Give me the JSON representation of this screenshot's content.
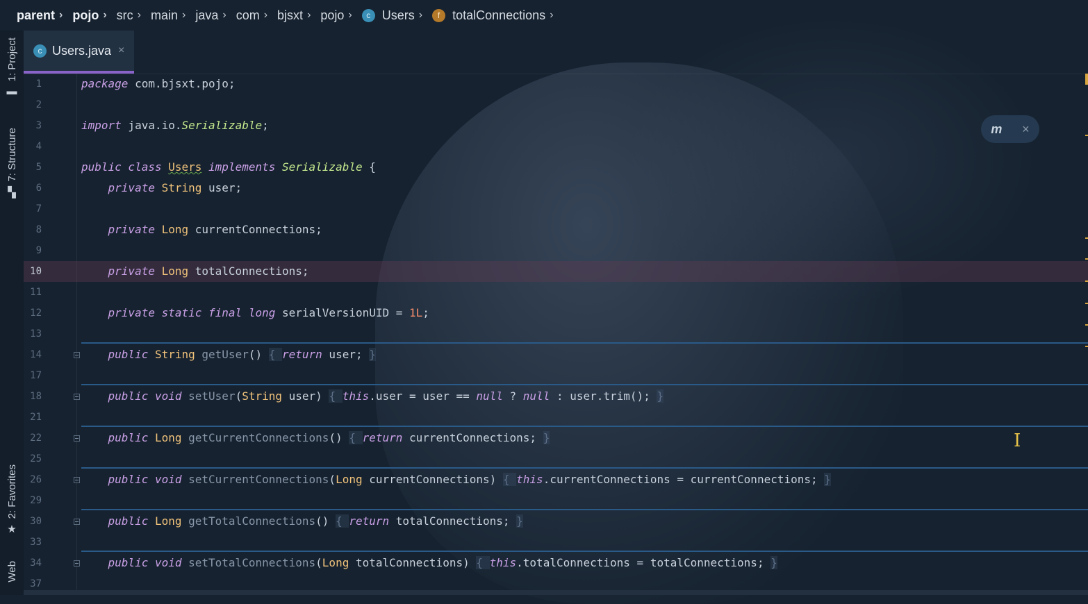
{
  "breadcrumb": [
    {
      "label": "parent",
      "bold": true
    },
    {
      "label": "pojo",
      "bold": true
    },
    {
      "label": "src"
    },
    {
      "label": "main"
    },
    {
      "label": "java"
    },
    {
      "label": "com"
    },
    {
      "label": "bjsxt"
    },
    {
      "label": "pojo"
    },
    {
      "label": "Users",
      "icon": "class-icon",
      "icon_glyph": "c"
    },
    {
      "label": "totalConnections",
      "icon": "field-icon",
      "icon_glyph": "f"
    }
  ],
  "toolstrip": {
    "project": {
      "label": "1: Project",
      "icon": "folder-icon"
    },
    "structure": {
      "label": "7: Structure",
      "icon": "structure-icon"
    },
    "favorites": {
      "label": "2: Favorites",
      "icon": "star-icon"
    },
    "web": {
      "label": "Web"
    }
  },
  "tab": {
    "label": "Users.java",
    "icon": "class-icon",
    "icon_glyph": "c",
    "close": "×"
  },
  "maven_popup": {
    "label": "m",
    "close": "×"
  },
  "colors": {
    "accent": "#8a63c9",
    "keyword": "#c9a0e6",
    "type": "#f0c27b",
    "number": "#f78c6c",
    "marker": "#d7a640"
  },
  "lines": [
    {
      "n": "1",
      "tokens": [
        [
          "kw",
          "package"
        ],
        [
          "pl",
          " com.bjsxt.pojo;"
        ]
      ]
    },
    {
      "n": "2",
      "tokens": []
    },
    {
      "n": "3",
      "tokens": [
        [
          "kw",
          "import"
        ],
        [
          "pl",
          " java.io."
        ],
        [
          "ty-i",
          "Serializable"
        ],
        [
          "pl",
          ";"
        ]
      ]
    },
    {
      "n": "4",
      "tokens": []
    },
    {
      "n": "5",
      "tokens": [
        [
          "kw",
          "public class "
        ],
        [
          "cls",
          "Users"
        ],
        [
          "kw",
          " implements "
        ],
        [
          "ty-i",
          "Serializable"
        ],
        [
          "pl",
          " {"
        ]
      ]
    },
    {
      "n": "6",
      "tokens": [
        [
          "pl",
          "    "
        ],
        [
          "kw",
          "private "
        ],
        [
          "ty",
          "String"
        ],
        [
          "pl",
          " user;"
        ]
      ]
    },
    {
      "n": "7",
      "tokens": []
    },
    {
      "n": "8",
      "tokens": [
        [
          "pl",
          "    "
        ],
        [
          "kw",
          "private "
        ],
        [
          "ty",
          "Long"
        ],
        [
          "pl",
          " currentConnections;"
        ]
      ]
    },
    {
      "n": "9",
      "tokens": []
    },
    {
      "n": "10",
      "current": true,
      "tokens": [
        [
          "pl",
          "    "
        ],
        [
          "kw",
          "private "
        ],
        [
          "ty",
          "Long"
        ],
        [
          "pl",
          " totalConnections;"
        ]
      ]
    },
    {
      "n": "11",
      "tokens": []
    },
    {
      "n": "12",
      "tokens": [
        [
          "pl",
          "    "
        ],
        [
          "kw",
          "private static final long "
        ],
        [
          "pl",
          "serialVersionUID = "
        ],
        [
          "nm",
          "1L"
        ],
        [
          "pl",
          ";"
        ]
      ]
    },
    {
      "n": "13",
      "tokens": []
    },
    {
      "n": "14",
      "fold": true,
      "sep": true,
      "tokens": [
        [
          "pl",
          "    "
        ],
        [
          "kw",
          "public "
        ],
        [
          "ty",
          "String"
        ],
        [
          "fn",
          " getUser"
        ],
        [
          "pl",
          "() "
        ],
        [
          "br",
          "{ "
        ],
        [
          "kw",
          "return"
        ],
        [
          "pl",
          " user; "
        ],
        [
          "br",
          "}"
        ]
      ]
    },
    {
      "n": "17",
      "tokens": []
    },
    {
      "n": "18",
      "fold": true,
      "sep": true,
      "tokens": [
        [
          "pl",
          "    "
        ],
        [
          "kw",
          "public void "
        ],
        [
          "fn",
          "setUser"
        ],
        [
          "pl",
          "("
        ],
        [
          "ty",
          "String"
        ],
        [
          "pl",
          " user) "
        ],
        [
          "br",
          "{ "
        ],
        [
          "kw",
          "this"
        ],
        [
          "pl",
          ".user = user == "
        ],
        [
          "kw",
          "null"
        ],
        [
          "pl",
          " ? "
        ],
        [
          "kw",
          "null"
        ],
        [
          "pl",
          " : user.trim(); "
        ],
        [
          "br",
          "}"
        ]
      ]
    },
    {
      "n": "21",
      "tokens": []
    },
    {
      "n": "22",
      "fold": true,
      "sep": true,
      "tokens": [
        [
          "pl",
          "    "
        ],
        [
          "kw",
          "public "
        ],
        [
          "ty",
          "Long"
        ],
        [
          "fn",
          " getCurrentConnections"
        ],
        [
          "pl",
          "() "
        ],
        [
          "br",
          "{ "
        ],
        [
          "kw",
          "return"
        ],
        [
          "pl",
          " currentConnections; "
        ],
        [
          "br",
          "}"
        ]
      ]
    },
    {
      "n": "25",
      "tokens": []
    },
    {
      "n": "26",
      "fold": true,
      "sep": true,
      "tokens": [
        [
          "pl",
          "    "
        ],
        [
          "kw",
          "public void "
        ],
        [
          "fn",
          "setCurrentConnections"
        ],
        [
          "pl",
          "("
        ],
        [
          "ty",
          "Long"
        ],
        [
          "pl",
          " currentConnections) "
        ],
        [
          "br",
          "{ "
        ],
        [
          "kw",
          "this"
        ],
        [
          "pl",
          ".currentConnections = currentConnections; "
        ],
        [
          "br",
          "}"
        ]
      ]
    },
    {
      "n": "29",
      "tokens": []
    },
    {
      "n": "30",
      "fold": true,
      "sep": true,
      "tokens": [
        [
          "pl",
          "    "
        ],
        [
          "kw",
          "public "
        ],
        [
          "ty",
          "Long"
        ],
        [
          "fn",
          " getTotalConnections"
        ],
        [
          "pl",
          "() "
        ],
        [
          "br",
          "{ "
        ],
        [
          "kw",
          "return"
        ],
        [
          "pl",
          " totalConnections; "
        ],
        [
          "br",
          "}"
        ]
      ]
    },
    {
      "n": "33",
      "tokens": []
    },
    {
      "n": "34",
      "fold": true,
      "sep": true,
      "tokens": [
        [
          "pl",
          "    "
        ],
        [
          "kw",
          "public void "
        ],
        [
          "fn",
          "setTotalConnections"
        ],
        [
          "pl",
          "("
        ],
        [
          "ty",
          "Long"
        ],
        [
          "pl",
          " totalConnections) "
        ],
        [
          "br",
          "{ "
        ],
        [
          "kw",
          "this"
        ],
        [
          "pl",
          ".totalConnections = totalConnections; "
        ],
        [
          "br",
          "}"
        ]
      ]
    },
    {
      "n": "37",
      "tokens": []
    }
  ]
}
